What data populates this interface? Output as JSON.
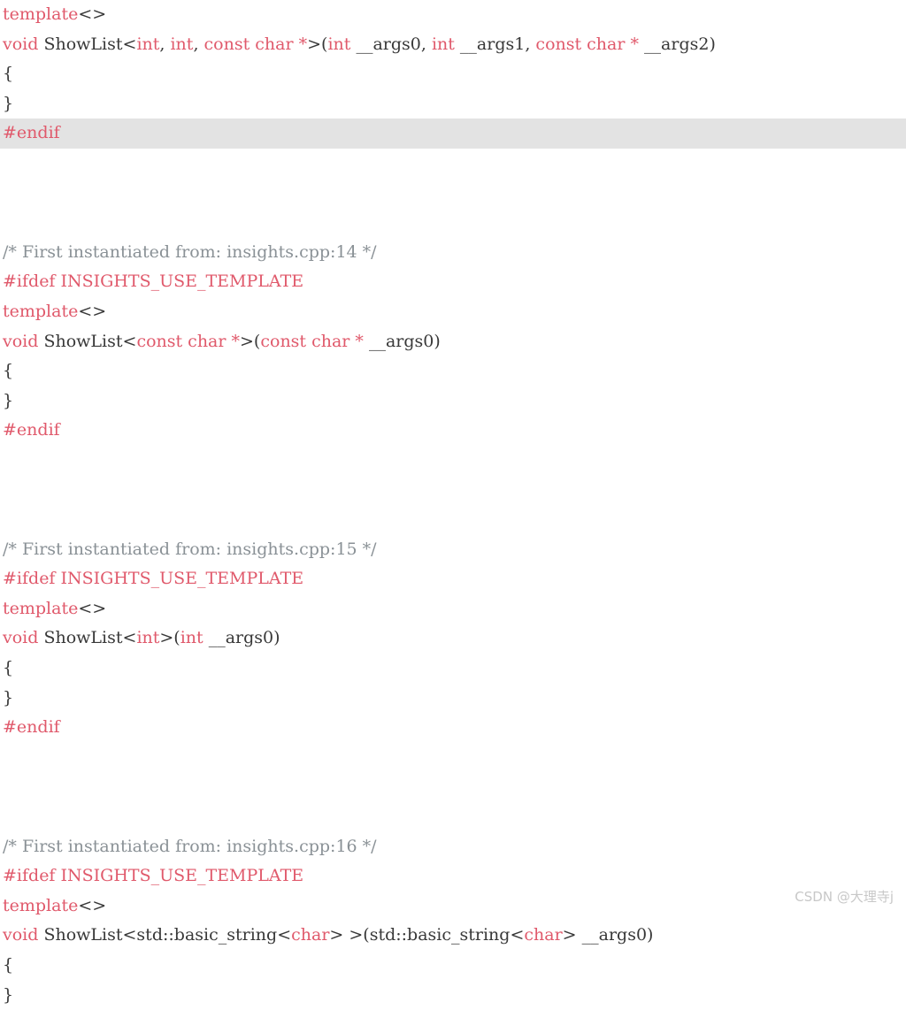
{
  "document": {
    "kind": "cpp-source-listing",
    "background_color": "#ffffff",
    "colors": {
      "keyword": "#e0596b",
      "preprocessor": "#e0596b",
      "type": "#e0596b",
      "comment": "#8a9196",
      "identifier": "#383838",
      "punctuation": "#383838",
      "highlight_row": "#e3e3e3",
      "watermark": "#c8c8c8"
    }
  },
  "watermark": {
    "text": "CSDN @大理寺j"
  },
  "lines": [
    {
      "id": "line-1",
      "highlight": false,
      "text": "template<>",
      "tokens": [
        {
          "t": "template",
          "c": "tok-kw"
        },
        {
          "t": "<>",
          "c": "tok-punct"
        }
      ]
    },
    {
      "id": "line-2",
      "highlight": false,
      "text": "void ShowList<int, int, const char *>(int __args0, int __args1, const char * __args2)",
      "tokens": [
        {
          "t": "void",
          "c": "tok-kw"
        },
        {
          "t": " ",
          "c": "tok-plain"
        },
        {
          "t": "ShowList",
          "c": "tok-ident"
        },
        {
          "t": "<",
          "c": "tok-punct"
        },
        {
          "t": "int",
          "c": "tok-type"
        },
        {
          "t": ", ",
          "c": "tok-punct"
        },
        {
          "t": "int",
          "c": "tok-type"
        },
        {
          "t": ", ",
          "c": "tok-punct"
        },
        {
          "t": "const char *",
          "c": "tok-type"
        },
        {
          "t": ">(",
          "c": "tok-punct"
        },
        {
          "t": "int",
          "c": "tok-type"
        },
        {
          "t": " __args0, ",
          "c": "tok-ident"
        },
        {
          "t": "int",
          "c": "tok-type"
        },
        {
          "t": " __args1, ",
          "c": "tok-ident"
        },
        {
          "t": "const char *",
          "c": "tok-type"
        },
        {
          "t": " __args2)",
          "c": "tok-ident"
        }
      ]
    },
    {
      "id": "line-3",
      "highlight": false,
      "text": "{",
      "tokens": [
        {
          "t": "{",
          "c": "tok-punct"
        }
      ]
    },
    {
      "id": "line-4",
      "highlight": false,
      "text": "}",
      "tokens": [
        {
          "t": "}",
          "c": "tok-punct"
        }
      ]
    },
    {
      "id": "line-5",
      "highlight": true,
      "text": "#endif",
      "tokens": [
        {
          "t": "#endif",
          "c": "tok-pp"
        }
      ]
    },
    {
      "id": "line-6",
      "highlight": false,
      "text": "",
      "tokens": []
    },
    {
      "id": "line-7",
      "highlight": false,
      "text": "",
      "tokens": []
    },
    {
      "id": "line-8",
      "highlight": false,
      "text": "",
      "tokens": []
    },
    {
      "id": "line-9",
      "highlight": false,
      "text": "/* First instantiated from: insights.cpp:14 */",
      "tokens": [
        {
          "t": "/* First instantiated from: insights.cpp:14 */",
          "c": "tok-comment"
        }
      ]
    },
    {
      "id": "line-10",
      "highlight": false,
      "text": "#ifdef INSIGHTS_USE_TEMPLATE",
      "tokens": [
        {
          "t": "#ifdef INSIGHTS_USE_TEMPLATE",
          "c": "tok-pp"
        }
      ]
    },
    {
      "id": "line-11",
      "highlight": false,
      "text": "template<>",
      "tokens": [
        {
          "t": "template",
          "c": "tok-kw"
        },
        {
          "t": "<>",
          "c": "tok-punct"
        }
      ]
    },
    {
      "id": "line-12",
      "highlight": false,
      "text": "void ShowList<const char *>(const char * __args0)",
      "tokens": [
        {
          "t": "void",
          "c": "tok-kw"
        },
        {
          "t": " ",
          "c": "tok-plain"
        },
        {
          "t": "ShowList",
          "c": "tok-ident"
        },
        {
          "t": "<",
          "c": "tok-punct"
        },
        {
          "t": "const char *",
          "c": "tok-type"
        },
        {
          "t": ">(",
          "c": "tok-punct"
        },
        {
          "t": "const char *",
          "c": "tok-type"
        },
        {
          "t": " __args0)",
          "c": "tok-ident"
        }
      ]
    },
    {
      "id": "line-13",
      "highlight": false,
      "text": "{",
      "tokens": [
        {
          "t": "{",
          "c": "tok-punct"
        }
      ]
    },
    {
      "id": "line-14",
      "highlight": false,
      "text": "}",
      "tokens": [
        {
          "t": "}",
          "c": "tok-punct"
        }
      ]
    },
    {
      "id": "line-15",
      "highlight": false,
      "text": "#endif",
      "tokens": [
        {
          "t": "#endif",
          "c": "tok-pp"
        }
      ]
    },
    {
      "id": "line-16",
      "highlight": false,
      "text": "",
      "tokens": []
    },
    {
      "id": "line-17",
      "highlight": false,
      "text": "",
      "tokens": []
    },
    {
      "id": "line-18",
      "highlight": false,
      "text": "",
      "tokens": []
    },
    {
      "id": "line-19",
      "highlight": false,
      "text": "/* First instantiated from: insights.cpp:15 */",
      "tokens": [
        {
          "t": "/* First instantiated from: insights.cpp:15 */",
          "c": "tok-comment"
        }
      ]
    },
    {
      "id": "line-20",
      "highlight": false,
      "text": "#ifdef INSIGHTS_USE_TEMPLATE",
      "tokens": [
        {
          "t": "#ifdef INSIGHTS_USE_TEMPLATE",
          "c": "tok-pp"
        }
      ]
    },
    {
      "id": "line-21",
      "highlight": false,
      "text": "template<>",
      "tokens": [
        {
          "t": "template",
          "c": "tok-kw"
        },
        {
          "t": "<>",
          "c": "tok-punct"
        }
      ]
    },
    {
      "id": "line-22",
      "highlight": false,
      "text": "void ShowList<int>(int __args0)",
      "tokens": [
        {
          "t": "void",
          "c": "tok-kw"
        },
        {
          "t": " ",
          "c": "tok-plain"
        },
        {
          "t": "ShowList",
          "c": "tok-ident"
        },
        {
          "t": "<",
          "c": "tok-punct"
        },
        {
          "t": "int",
          "c": "tok-type"
        },
        {
          "t": ">(",
          "c": "tok-punct"
        },
        {
          "t": "int",
          "c": "tok-type"
        },
        {
          "t": " __args0)",
          "c": "tok-ident"
        }
      ]
    },
    {
      "id": "line-23",
      "highlight": false,
      "text": "{",
      "tokens": [
        {
          "t": "{",
          "c": "tok-punct"
        }
      ]
    },
    {
      "id": "line-24",
      "highlight": false,
      "text": "}",
      "tokens": [
        {
          "t": "}",
          "c": "tok-punct"
        }
      ]
    },
    {
      "id": "line-25",
      "highlight": false,
      "text": "#endif",
      "tokens": [
        {
          "t": "#endif",
          "c": "tok-pp"
        }
      ]
    },
    {
      "id": "line-26",
      "highlight": false,
      "text": "",
      "tokens": []
    },
    {
      "id": "line-27",
      "highlight": false,
      "text": "",
      "tokens": []
    },
    {
      "id": "line-28",
      "highlight": false,
      "text": "",
      "tokens": []
    },
    {
      "id": "line-29",
      "highlight": false,
      "text": "/* First instantiated from: insights.cpp:16 */",
      "tokens": [
        {
          "t": "/* First instantiated from: insights.cpp:16 */",
          "c": "tok-comment"
        }
      ]
    },
    {
      "id": "line-30",
      "highlight": false,
      "text": "#ifdef INSIGHTS_USE_TEMPLATE",
      "tokens": [
        {
          "t": "#ifdef INSIGHTS_USE_TEMPLATE",
          "c": "tok-pp"
        }
      ]
    },
    {
      "id": "line-31",
      "highlight": false,
      "text": "template<>",
      "tokens": [
        {
          "t": "template",
          "c": "tok-kw"
        },
        {
          "t": "<>",
          "c": "tok-punct"
        }
      ]
    },
    {
      "id": "line-32",
      "highlight": false,
      "text": "void ShowList<std::basic_string<char> >(std::basic_string<char> __args0)",
      "tokens": [
        {
          "t": "void",
          "c": "tok-kw"
        },
        {
          "t": " ",
          "c": "tok-plain"
        },
        {
          "t": "ShowList",
          "c": "tok-ident"
        },
        {
          "t": "<std::basic_string<",
          "c": "tok-punct"
        },
        {
          "t": "char",
          "c": "tok-type"
        },
        {
          "t": "> >(std::basic_string<",
          "c": "tok-punct"
        },
        {
          "t": "char",
          "c": "tok-type"
        },
        {
          "t": "> __args0)",
          "c": "tok-punct"
        }
      ]
    },
    {
      "id": "line-33",
      "highlight": false,
      "text": "{",
      "tokens": [
        {
          "t": "{",
          "c": "tok-punct"
        }
      ]
    },
    {
      "id": "line-34",
      "highlight": false,
      "text": "}",
      "tokens": [
        {
          "t": "}",
          "c": "tok-punct"
        }
      ]
    }
  ]
}
